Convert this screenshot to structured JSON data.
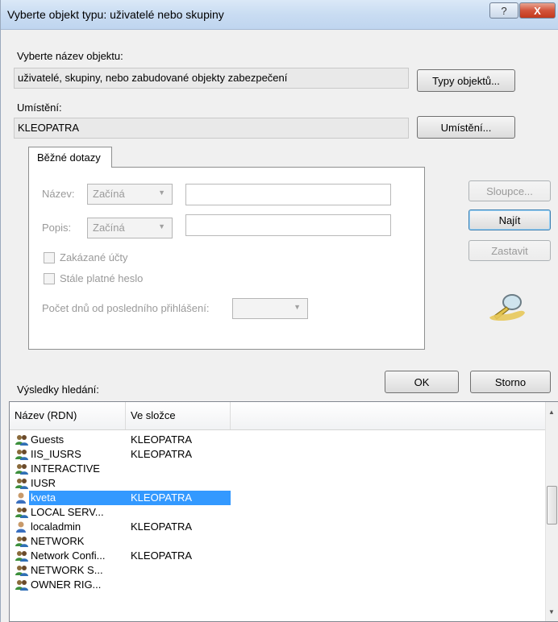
{
  "window": {
    "title": "Vyberte objekt typu: uživatelé nebo skupiny",
    "help_label": "?",
    "close_label": "X"
  },
  "object_type": {
    "label": "Vyberte název objektu:",
    "value": "uživatelé, skupiny, nebo zabudované objekty zabezpečení",
    "button": "Typy objektů..."
  },
  "location": {
    "label": "Umístění:",
    "value": "KLEOPATRA",
    "button": "Umístění..."
  },
  "tab": {
    "label": "Běžné dotazy"
  },
  "query": {
    "name_label": "Název:",
    "name_mode": "Začíná",
    "desc_label": "Popis:",
    "desc_mode": "Začíná",
    "disabled_accounts": "Zakázané účty",
    "non_expiring_password": "Stále platné heslo",
    "days_label": "Počet dnů od posledního přihlášení:"
  },
  "buttons": {
    "columns": "Sloupce...",
    "find": "Najít",
    "stop": "Zastavit",
    "ok": "OK",
    "cancel": "Storno"
  },
  "results": {
    "label": "Výsledky hledání:",
    "columns": [
      "Název (RDN)",
      "Ve složce"
    ],
    "rows": [
      {
        "name": "Guests",
        "folder": "KLEOPATRA",
        "icon": "group-icon"
      },
      {
        "name": "IIS_IUSRS",
        "folder": "KLEOPATRA",
        "icon": "group-icon"
      },
      {
        "name": "INTERACTIVE",
        "folder": "",
        "icon": "group-icon"
      },
      {
        "name": "IUSR",
        "folder": "",
        "icon": "group-icon"
      },
      {
        "name": "kveta",
        "folder": "KLEOPATRA",
        "icon": "user-icon",
        "selected": true
      },
      {
        "name": "LOCAL SERV...",
        "folder": "",
        "icon": "group-icon"
      },
      {
        "name": "localadmin",
        "folder": "KLEOPATRA",
        "icon": "user-icon"
      },
      {
        "name": "NETWORK",
        "folder": "",
        "icon": "group-icon"
      },
      {
        "name": "Network Confi...",
        "folder": "KLEOPATRA",
        "icon": "group-icon"
      },
      {
        "name": "NETWORK S...",
        "folder": "",
        "icon": "group-icon"
      },
      {
        "name": "OWNER RIG...",
        "folder": "",
        "icon": "group-icon"
      }
    ]
  },
  "colors": {
    "selection": "#3399ff",
    "disabled_text": "#9a9a9a",
    "title_gradient_top": "#dbe8f7"
  }
}
